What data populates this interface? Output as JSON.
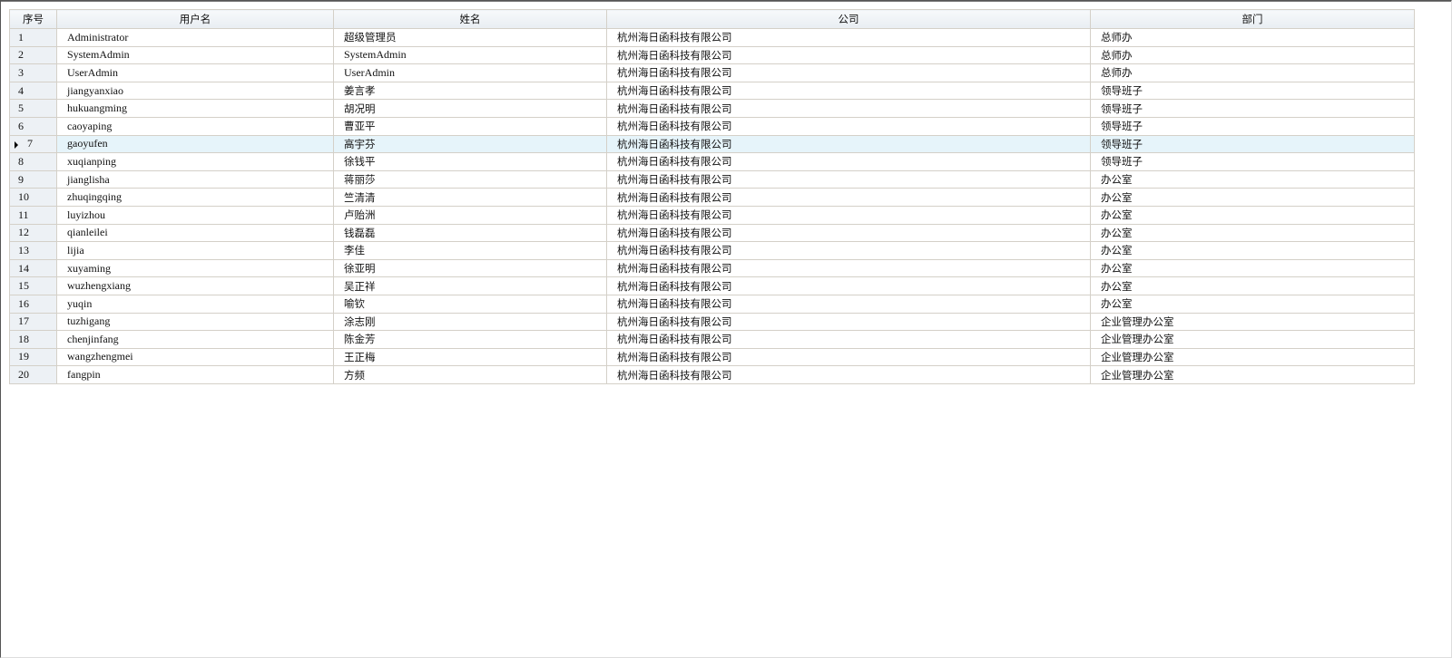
{
  "columns": [
    "序号",
    "用户名",
    "姓名",
    "公司",
    "部门"
  ],
  "selected_row": 7,
  "rows": [
    [
      "1",
      "Administrator",
      "超级管理员",
      "杭州海日函科技有限公司",
      "总师办"
    ],
    [
      "2",
      "SystemAdmin",
      "SystemAdmin",
      "杭州海日函科技有限公司",
      "总师办"
    ],
    [
      "3",
      "UserAdmin",
      "UserAdmin",
      "杭州海日函科技有限公司",
      "总师办"
    ],
    [
      "4",
      "jiangyanxiao",
      "姜言孝",
      "杭州海日函科技有限公司",
      "领导班子"
    ],
    [
      "5",
      "hukuangming",
      "胡况明",
      "杭州海日函科技有限公司",
      "领导班子"
    ],
    [
      "6",
      "caoyaping",
      "曹亚平",
      "杭州海日函科技有限公司",
      "领导班子"
    ],
    [
      "7",
      "gaoyufen",
      "高宇芬",
      "杭州海日函科技有限公司",
      "领导班子"
    ],
    [
      "8",
      "xuqianping",
      "徐钱平",
      "杭州海日函科技有限公司",
      "领导班子"
    ],
    [
      "9",
      "jianglisha",
      "蒋丽莎",
      "杭州海日函科技有限公司",
      "办公室"
    ],
    [
      "10",
      "zhuqingqing",
      "竺清清",
      "杭州海日函科技有限公司",
      "办公室"
    ],
    [
      "11",
      "luyizhou",
      "卢贻洲",
      "杭州海日函科技有限公司",
      "办公室"
    ],
    [
      "12",
      "qianleilei",
      "钱磊磊",
      "杭州海日函科技有限公司",
      "办公室"
    ],
    [
      "13",
      "lijia",
      "李佳",
      "杭州海日函科技有限公司",
      "办公室"
    ],
    [
      "14",
      "xuyaming",
      "徐亚明",
      "杭州海日函科技有限公司",
      "办公室"
    ],
    [
      "15",
      "wuzhengxiang",
      "吴正祥",
      "杭州海日函科技有限公司",
      "办公室"
    ],
    [
      "16",
      "yuqin",
      "喻钦",
      "杭州海日函科技有限公司",
      "办公室"
    ],
    [
      "17",
      "tuzhigang",
      "涂志刚",
      "杭州海日函科技有限公司",
      "企业管理办公室"
    ],
    [
      "18",
      "chenjinfang",
      "陈金芳",
      "杭州海日函科技有限公司",
      "企业管理办公室"
    ],
    [
      "19",
      "wangzhengmei",
      "王正梅",
      "杭州海日函科技有限公司",
      "企业管理办公室"
    ],
    [
      "20",
      "fangpin",
      "方频",
      "杭州海日函科技有限公司",
      "企业管理办公室"
    ]
  ]
}
